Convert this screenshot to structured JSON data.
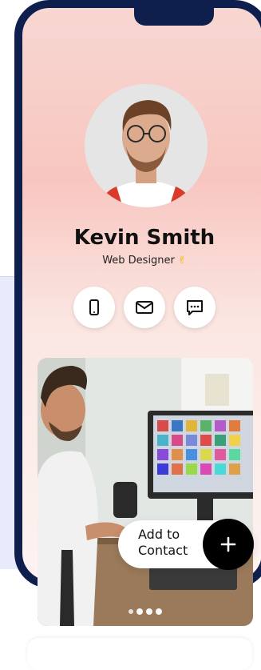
{
  "profile": {
    "name": "Kevin Smith",
    "role": "Web Designer",
    "role_emoji": "✌"
  },
  "contact_actions": [
    {
      "icon": "phone-icon"
    },
    {
      "icon": "mail-icon"
    },
    {
      "icon": "chat-icon"
    }
  ],
  "gallery": {
    "slide_count": 4,
    "active_slide": 1
  },
  "add_contact": {
    "label_line1": "Add to",
    "label_line2": "Contact",
    "icon": "plus-icon"
  },
  "colors": {
    "frame": "#0e1f4d",
    "gradient_top": "#f7d7d2",
    "gradient_mid": "#f8c6c0",
    "accent": "#000000"
  }
}
